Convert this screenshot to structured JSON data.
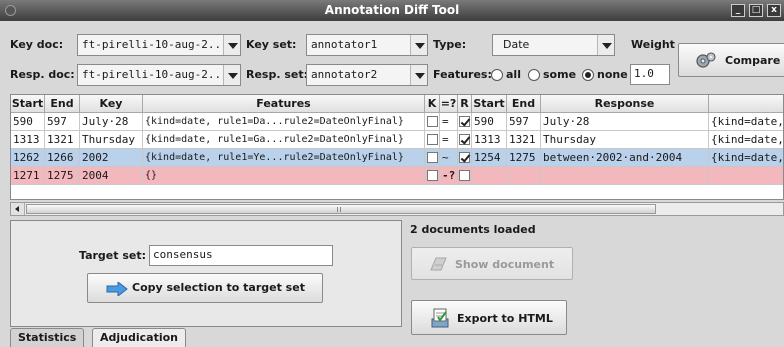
{
  "window": {
    "title": "Annotation Diff Tool",
    "min": "_",
    "max": "□",
    "close": "x"
  },
  "controls": {
    "key_doc_label": "Key doc:",
    "key_doc_value": "ft-pirelli-10-aug-2...",
    "key_set_label": "Key set:",
    "key_set_value": "annotator1",
    "type_label": "Type:",
    "type_value": "Date",
    "weight_label": "Weight",
    "resp_doc_label": "Resp. doc:",
    "resp_doc_value": "ft-pirelli-10-aug-2...",
    "resp_set_label": "Resp. set:",
    "resp_set_value": "annotator2",
    "features_label": "Features:",
    "features_options": [
      "all",
      "some",
      "none"
    ],
    "features_selected": "none",
    "weight_value": "1.0",
    "compare_label": "Compare"
  },
  "table": {
    "headers": [
      "Start",
      "End",
      "Key",
      "Features",
      "K",
      "=?",
      "R",
      "Start",
      "End",
      "Response",
      ""
    ],
    "rows": [
      {
        "key_start": "590",
        "key_end": "597",
        "key": "July·28",
        "key_features": "{kind=date, rule1=Da...rule2=DateOnlyFinal}",
        "k_checked": false,
        "match": "=",
        "r_checked": true,
        "resp_start": "590",
        "resp_end": "597",
        "response": "July·28",
        "resp_features": "{kind=date,",
        "state": "normal"
      },
      {
        "key_start": "1313",
        "key_end": "1321",
        "key": "Thursday",
        "key_features": "{kind=date, rule1=Ga...rule2=DateOnlyFinal}",
        "k_checked": false,
        "match": "=",
        "r_checked": true,
        "resp_start": "1313",
        "resp_end": "1321",
        "response": "Thursday",
        "resp_features": "{kind=date,",
        "state": "normal"
      },
      {
        "key_start": "1262",
        "key_end": "1266",
        "key": "2002",
        "key_features": "{kind=date, rule1=Ye...rule2=DateOnlyFinal}",
        "k_checked": false,
        "match": "~",
        "r_checked": true,
        "resp_start": "1254",
        "resp_end": "1275",
        "response": "between·2002·and·2004",
        "resp_features": "{kind=date,",
        "state": "selected"
      },
      {
        "key_start": "1271",
        "key_end": "1275",
        "key": "2004",
        "key_features": "{}",
        "k_checked": false,
        "match": "-?",
        "r_checked": false,
        "resp_start": "",
        "resp_end": "",
        "response": "",
        "resp_features": "",
        "state": "missing"
      }
    ]
  },
  "panel": {
    "target_set_label": "Target set:",
    "target_set_value": "consensus",
    "copy_button_label": "Copy selection to target set"
  },
  "status": {
    "documents_loaded": "2 documents loaded"
  },
  "actions": {
    "show_document_label": "Show document",
    "export_label": "Export to HTML"
  },
  "tabs": [
    {
      "label": "Statistics"
    },
    {
      "label": "Adjudication"
    }
  ],
  "active_tab": "Adjudication",
  "colors": {
    "selected_row": "#b9d1ea",
    "missing_row": "#f3b8be",
    "title_bar": "#3d3d3d"
  },
  "icons": {
    "compare": "gears-icon",
    "copy": "arrow-right-icon",
    "show_document": "document-icon",
    "export": "export-icon"
  }
}
